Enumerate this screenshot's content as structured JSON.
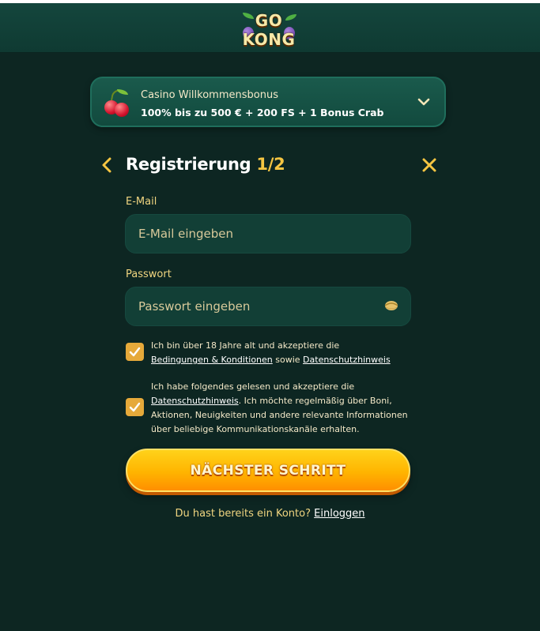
{
  "header": {
    "logo_top": "GO",
    "logo_bottom": "KONG"
  },
  "bonus": {
    "title": "Casino Willkommensbonus",
    "description": "100% bis zu 500 € + 200 FS + 1 Bonus Crab"
  },
  "registration": {
    "title": "Registrierung",
    "step": "1/2"
  },
  "email": {
    "label": "E-Mail",
    "placeholder": "E-Mail eingeben",
    "value": ""
  },
  "password": {
    "label": "Passwort",
    "placeholder": "Passwort eingeben",
    "value": ""
  },
  "consent1": {
    "checked": true,
    "text_before": "Ich bin über 18 Jahre alt und akzeptiere die",
    "link1": "Bedingungen & Konditionen",
    "middle": "sowie",
    "link2": "Datenschutzhinweis"
  },
  "consent2": {
    "checked": true,
    "text_before": "Ich habe folgendes gelesen und akzeptiere die",
    "link": "Datenschutzhinweis",
    "text_after": ". Ich möchte regelmäßig über Boni, Aktionen, Neuigkeiten und andere relevante Informationen über beliebige Kommunikationskanäle erhalten."
  },
  "next_button": {
    "label": "NÄCHSTER SCHRITT"
  },
  "login": {
    "prompt": "Du hast bereits ein Konto?",
    "link": "Einloggen"
  },
  "icons": {
    "back": "chevron-left-icon",
    "close": "close-icon",
    "expand": "chevron-down-icon",
    "eye": "eye-icon",
    "check": "check-icon",
    "bonus": "cherry-icon"
  },
  "colors": {
    "background": "#0d2622",
    "accent": "#f5c542",
    "button": "#ffb400",
    "checkbox": "#e6a93a"
  }
}
